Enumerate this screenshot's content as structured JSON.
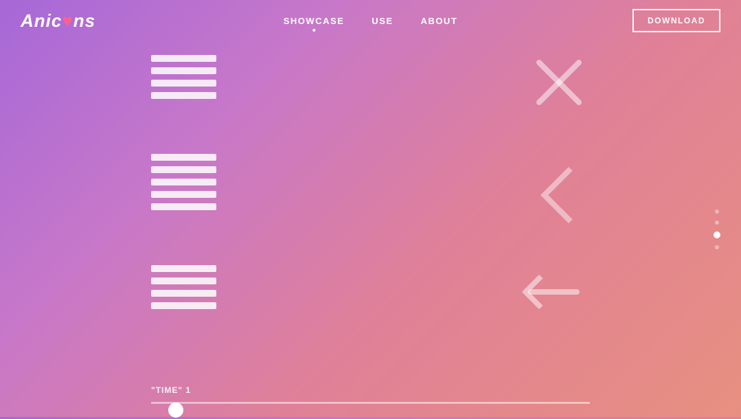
{
  "header": {
    "logo": "Anicns",
    "nav": {
      "showcase_label": "SHOWCASE",
      "use_label": "USE",
      "about_label": "AbouT"
    },
    "download_label": "DOWNLOAD"
  },
  "icons_left": {
    "hamburger_1": {
      "lines": 4
    },
    "hamburger_2": {
      "lines": 5
    },
    "hamburger_3": {
      "lines": 4
    }
  },
  "icons_right": {
    "icon_1_type": "x",
    "icon_2_type": "chevron-left",
    "icon_3_type": "arrow-left"
  },
  "dots": {
    "items": [
      {
        "active": false
      },
      {
        "active": false
      },
      {
        "active": true
      },
      {
        "active": false
      }
    ]
  },
  "bottom_controls": {
    "time_label": "\"TIME\" 1",
    "slider_min": 0,
    "slider_max": 100,
    "slider_value": 4
  }
}
